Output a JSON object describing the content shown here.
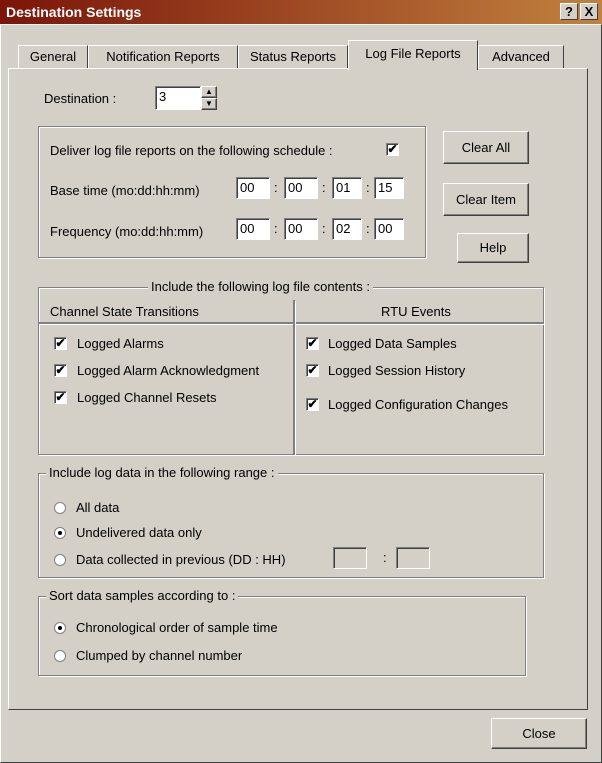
{
  "window": {
    "title": "Destination Settings",
    "help_btn": "?",
    "close_btn": "X",
    "title_gradient": [
      "#7b1409",
      "#c2813e"
    ]
  },
  "tabs": [
    {
      "label": "General"
    },
    {
      "label": "Notification Reports"
    },
    {
      "label": "Status Reports"
    },
    {
      "label": "Log File Reports",
      "active": true
    },
    {
      "label": "Advanced"
    }
  ],
  "destination": {
    "label": "Destination :",
    "value": "3"
  },
  "schedule": {
    "deliver_label": "Deliver log file reports on the following schedule :",
    "deliver_checked": "✔",
    "base_label": "Base time (mo:dd:hh:mm)",
    "base_values": [
      "00",
      "00",
      "01",
      "15"
    ],
    "freq_label": "Frequency  (mo:dd:hh:mm)",
    "freq_values": [
      "00",
      "00",
      "02",
      "00"
    ],
    "sep": ":"
  },
  "buttons": {
    "clear_all": "Clear All",
    "clear_item": "Clear Item",
    "help": "Help",
    "close": "Close"
  },
  "contents": {
    "legend": "Include the following log file contents :",
    "col1_header": "Channel State Transitions",
    "col2_header": "RTU Events",
    "col1_items": [
      {
        "label": "Logged Alarms",
        "mark": "✔"
      },
      {
        "label": "Logged Alarm Acknowledgment",
        "mark": "✔"
      },
      {
        "label": "Logged Channel Resets",
        "mark": "✔"
      }
    ],
    "col2_items": [
      {
        "label": "Logged Data Samples",
        "mark": "✔"
      },
      {
        "label": "Logged Session History",
        "mark": "✔"
      },
      {
        "label": "Logged Configuration Changes",
        "mark": "✔"
      }
    ]
  },
  "range": {
    "legend": "Include log data in the following range :",
    "options": [
      {
        "label": "All data",
        "selected": false
      },
      {
        "label": "Undelivered data only",
        "selected": true
      },
      {
        "label": "Data collected in previous (DD : HH)",
        "selected": false
      }
    ],
    "sep": ":"
  },
  "sort": {
    "legend": "Sort data samples according to :",
    "options": [
      {
        "label": "Chronological order of sample time",
        "selected": true
      },
      {
        "label": "Clumped by channel number",
        "selected": false
      }
    ]
  }
}
